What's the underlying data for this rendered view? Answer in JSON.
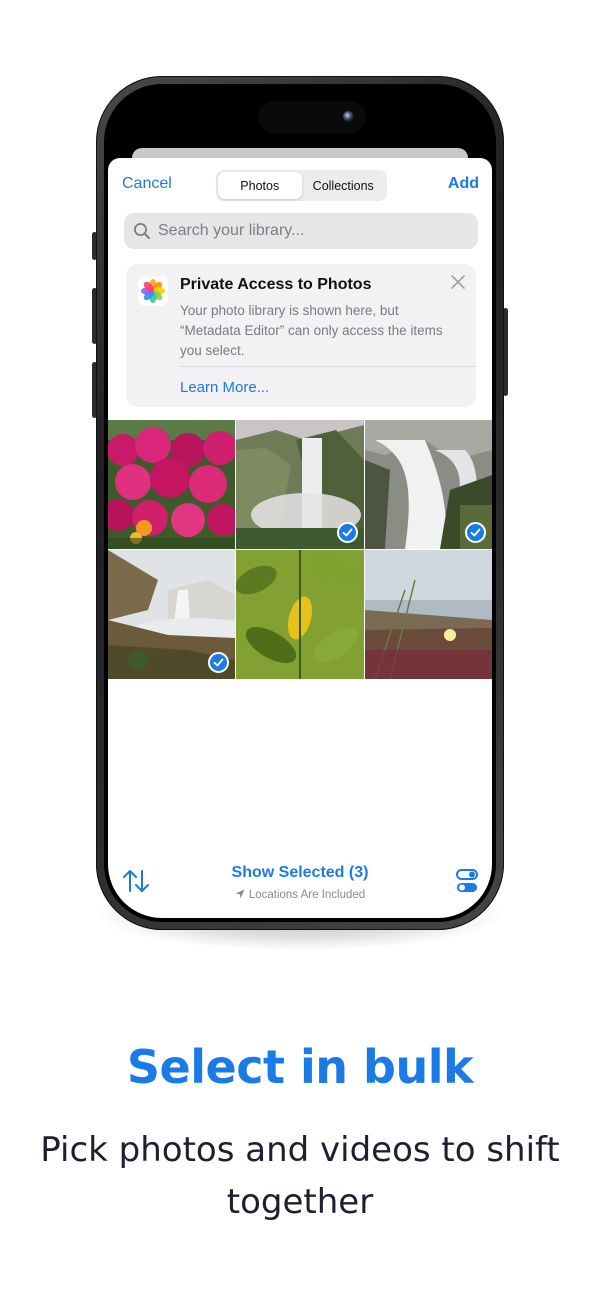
{
  "picker": {
    "cancel_label": "Cancel",
    "add_label": "Add",
    "segments": [
      {
        "label": "Photos",
        "active": true
      },
      {
        "label": "Collections",
        "active": false
      }
    ],
    "search_placeholder": "Search your library...",
    "notice": {
      "title": "Private Access to Photos",
      "body": "Your photo library is shown here, but “Metadata Editor” can only access the items you select.",
      "link_label": "Learn More..."
    },
    "photos": [
      {
        "subject": "pink flowers",
        "selected": false
      },
      {
        "subject": "waterfall cliff",
        "selected": true
      },
      {
        "subject": "waterfall rocks",
        "selected": true
      },
      {
        "subject": "waterfall coast",
        "selected": true
      },
      {
        "subject": "green leaves",
        "selected": false
      },
      {
        "subject": "coastal plants",
        "selected": false
      }
    ],
    "show_selected_label": "Show Selected (3)",
    "location_note": "Locations Are Included"
  },
  "marketing": {
    "headline": "Select in bulk",
    "subline": "Pick photos and videos to shift together"
  },
  "colors": {
    "accent": "#1a7ae6",
    "headline": "#1a7ae6",
    "subline": "#1c2030"
  },
  "icons": [
    "search-icon",
    "close-icon",
    "photos-app-icon",
    "checkmark-icon",
    "sort-arrows-icon",
    "location-arrow-icon",
    "toggles-icon"
  ]
}
